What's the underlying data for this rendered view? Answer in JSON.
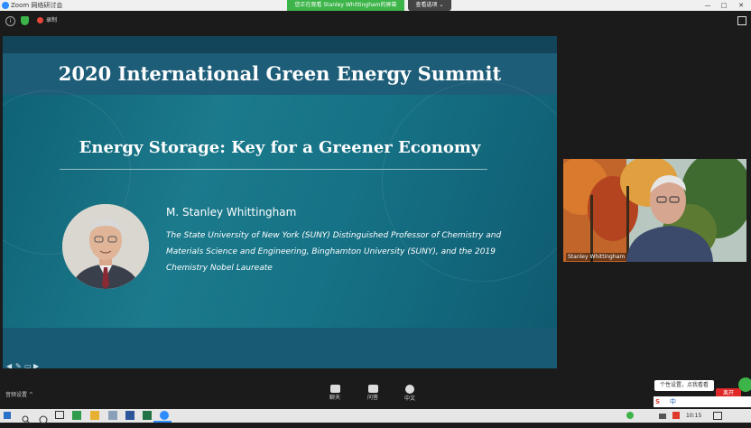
{
  "window": {
    "title": "Zoom 网络研讨会",
    "share_banner": "您正在观看 Stanley Whittingham的屏幕",
    "view_options": "查看选项 ⌄",
    "controls": [
      "—",
      "□",
      "✕"
    ]
  },
  "toolbar": {
    "record_label": "录制"
  },
  "slide": {
    "title": "2020 International Green Energy Summit",
    "subtitle": "Energy Storage: Key for a Greener Economy",
    "speaker_name": "M. Stanley Whittingham",
    "speaker_bio": "The State University of New York (SUNY) Distinguished Professor of Chemistry and Materials Science and Engineering, Binghamton University (SUNY), and the 2019 Chemistry Nobel Laureate",
    "nav_icons": [
      "arrow-left-icon",
      "pen-icon",
      "menu-icon",
      "arrow-right-icon"
    ]
  },
  "video": {
    "participant_name": "Stanley Whittingham"
  },
  "meeting_controls": {
    "audio_settings": "音频设置 ^",
    "items": [
      {
        "label": "聊天",
        "icon": "chat-icon"
      },
      {
        "label": "问答",
        "icon": "qa-icon"
      },
      {
        "label": "中文",
        "icon": "interpretation-icon"
      }
    ],
    "tooltip": "个性设置，点我看看",
    "leave": "离开"
  },
  "taskbar": {
    "time": "10:15",
    "ime": "中"
  },
  "colors": {
    "slide_header": "#1d5d78",
    "slide_body": "#167286",
    "banner_green": "#3cb449",
    "leave_red": "#e02828"
  }
}
